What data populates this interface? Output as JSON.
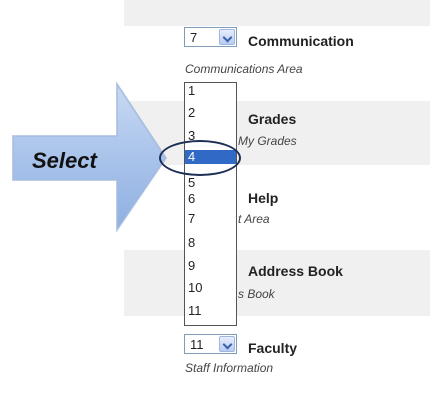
{
  "rows": [
    {
      "title": "Communication",
      "subtitle": "Communications Area",
      "select_value": "7"
    },
    {
      "title": "Grades",
      "subtitle": "My Grades"
    },
    {
      "title": "Help",
      "subtitle": "t Area"
    },
    {
      "title": "Address Book",
      "subtitle": "s Book"
    },
    {
      "title": "Faculty",
      "subtitle": "Staff Information",
      "select_value": "11"
    }
  ],
  "dropdown": {
    "options": [
      "1",
      "2",
      "3",
      "4",
      "5",
      "6",
      "7",
      "8",
      "9",
      "10",
      "11"
    ],
    "selected_index": 3
  },
  "callout": {
    "label": "Select"
  },
  "colors": {
    "band": "#f0f0f0",
    "highlight": "#3169c6",
    "arrow": "#9fb8e0"
  }
}
